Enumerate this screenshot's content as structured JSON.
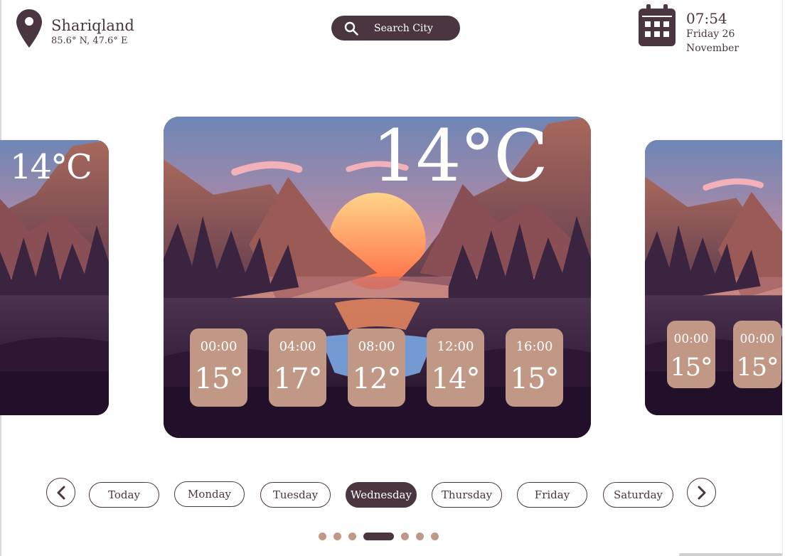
{
  "location": {
    "city": "Shariqland",
    "coords": "85.6° N, 47.6° E",
    "icon": "map-pin-icon"
  },
  "search": {
    "label": "Search City",
    "icon": "search-icon"
  },
  "datetime": {
    "time": "07:54",
    "day_line": "Friday 26",
    "month_line": "November",
    "icon": "calendar-icon"
  },
  "cards": {
    "left": {
      "temperature": "14°C"
    },
    "main": {
      "temperature": "14°C",
      "hourly": [
        {
          "time": "00:00",
          "temp": "15°"
        },
        {
          "time": "04:00",
          "temp": "17°"
        },
        {
          "time": "08:00",
          "temp": "12°"
        },
        {
          "time": "12:00",
          "temp": "14°"
        },
        {
          "time": "16:00",
          "temp": "15°"
        }
      ]
    },
    "right": {
      "hourly": [
        {
          "time": "00:00",
          "temp": "15°"
        },
        {
          "time": "00:00",
          "temp": "15°"
        }
      ]
    }
  },
  "days": [
    "Today",
    "Monday",
    "Tuesday",
    "Wednesday",
    "Thursday",
    "Friday",
    "Saturday"
  ],
  "active_day": "Wednesday",
  "pagination": {
    "count": 7,
    "active_index": 3
  },
  "colors": {
    "primary": "#4a3641",
    "accent": "#c19786",
    "background": "#ffffff"
  }
}
